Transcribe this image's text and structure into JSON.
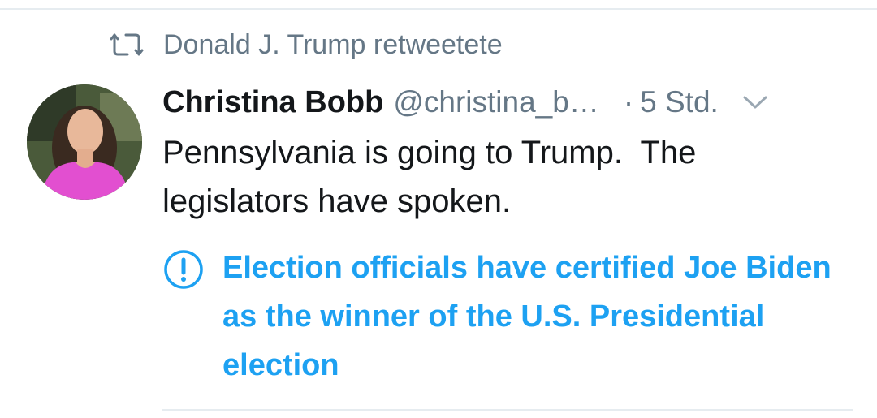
{
  "retweet": {
    "text": "Donald J. Trump retweetete"
  },
  "tweet": {
    "display_name": "Christina Bobb",
    "handle": "@christina_b…",
    "dot": "·",
    "timestamp": "5 Std.",
    "text": "Pennsylvania is going to Trump.  The legislators have spoken."
  },
  "notice": {
    "text": "Election officials have certified Joe Biden as the winner of the U.S. Presidential election"
  },
  "icons": {
    "retweet": "retweet-icon",
    "avatar": "avatar",
    "menu": "chevron-down-icon",
    "info": "info-icon"
  },
  "colors": {
    "accent": "#1da1f2",
    "secondary_text": "#657786",
    "primary_text": "#14171a",
    "divider": "#e6ecf0"
  }
}
